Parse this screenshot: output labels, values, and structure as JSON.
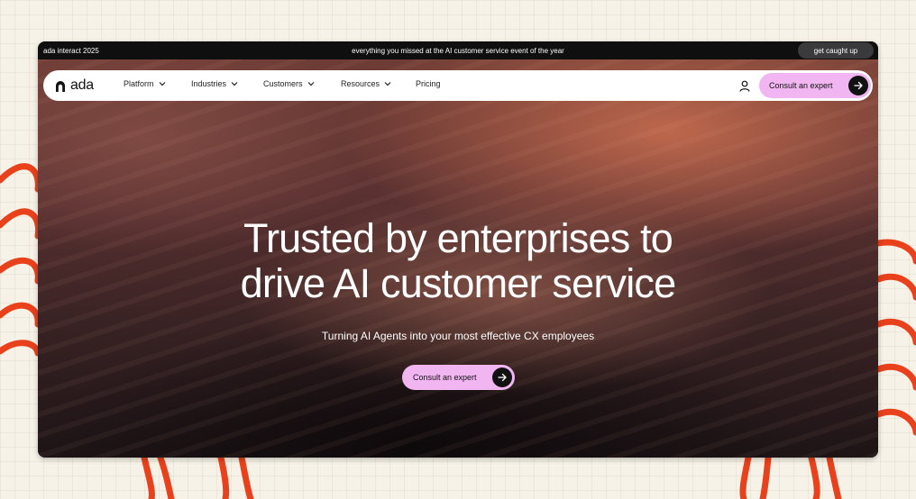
{
  "announcement": {
    "left_text": "ada interact 2025",
    "center_text": "everything you missed at the AI customer service event of the year",
    "button_label": "get caught up"
  },
  "nav": {
    "logo_text": "ada",
    "items": [
      {
        "label": "Platform",
        "has_dropdown": true
      },
      {
        "label": "Industries",
        "has_dropdown": true
      },
      {
        "label": "Customers",
        "has_dropdown": true
      },
      {
        "label": "Resources",
        "has_dropdown": true
      },
      {
        "label": "Pricing",
        "has_dropdown": false
      }
    ],
    "cta_label": "Consult an expert",
    "user_icon": "user-icon"
  },
  "hero": {
    "headline_line1": "Trusted by enterprises to",
    "headline_line2": "drive AI customer service",
    "subheadline": "Turning AI Agents into your most effective CX employees",
    "cta_label": "Consult an expert"
  },
  "colors": {
    "cta_pink": "#f1b6f1",
    "announcement_bg": "#0f0f10",
    "page_bg": "#f6f2e8",
    "decor_red": "#e8411c"
  }
}
